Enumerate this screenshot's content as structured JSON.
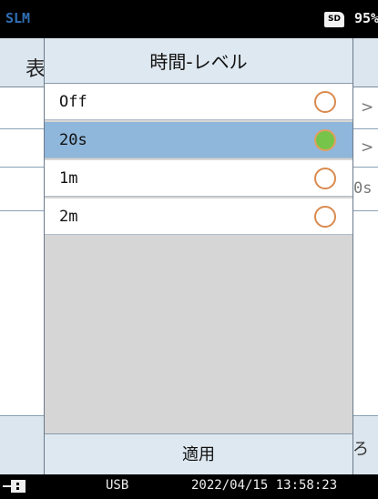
{
  "status_bar": {
    "app_name": "SLM",
    "storage": "SD",
    "battery": "95%"
  },
  "background_screen": {
    "title_fragment": "表",
    "row_arrow": ">",
    "row_value_fragment": "0s",
    "bottom_fragment": "ろ"
  },
  "dialog": {
    "title": "時間-レベル",
    "options": [
      {
        "label": "Off",
        "selected": false
      },
      {
        "label": "20s",
        "selected": true
      },
      {
        "label": "1m",
        "selected": false
      },
      {
        "label": "2m",
        "selected": false
      }
    ],
    "apply_label": "適用"
  },
  "footer": {
    "connection": "USB",
    "datetime": "2022/04/15  13:58:23"
  },
  "colors": {
    "app_name": "#2f6fb5",
    "selected_row": "#8fb6db",
    "radio_checked": "#76c44a",
    "radio_ring": "#d98a4e",
    "header_bg": "#dee8f0"
  }
}
